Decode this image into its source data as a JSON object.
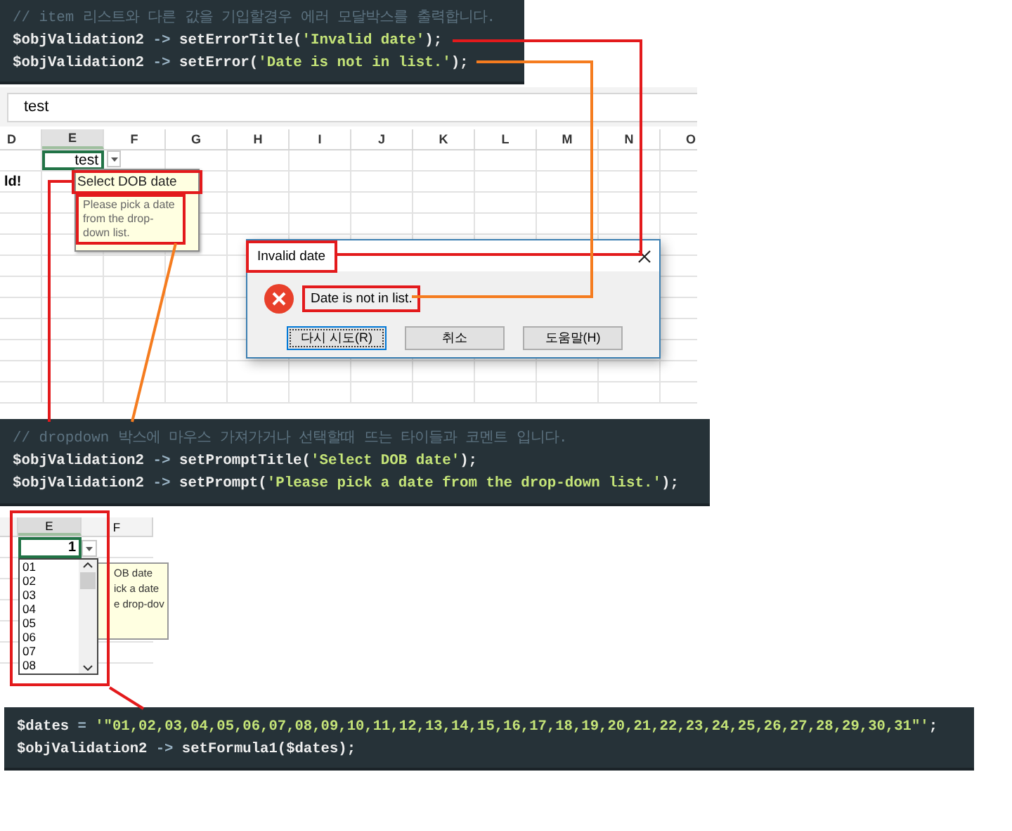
{
  "error_code": {
    "lines": [
      [
        {
          "kind": "comment",
          "text": "// item 리스트와 다른 값을 기입할경우 에러 모달박스를 출력합니다."
        }
      ],
      [
        {
          "kind": "plain",
          "text": "$objValidation2 "
        },
        {
          "kind": "operator",
          "text": "->"
        },
        {
          "kind": "plain",
          "text": " setErrorTitle("
        },
        {
          "kind": "string",
          "text": "'Invalid date'"
        },
        {
          "kind": "plain",
          "text": ");"
        }
      ],
      [
        {
          "kind": "plain",
          "text": "$objValidation2 "
        },
        {
          "kind": "operator",
          "text": "->"
        },
        {
          "kind": "plain",
          "text": " setError("
        },
        {
          "kind": "string",
          "text": "'Date is not in list.'"
        },
        {
          "kind": "plain",
          "text": ");"
        }
      ]
    ]
  },
  "spreadsheet": {
    "formula_bar": "test",
    "columns": [
      {
        "label": "D",
        "selected": false
      },
      {
        "label": "E",
        "selected": true
      },
      {
        "label": "F",
        "selected": false
      },
      {
        "label": "G",
        "selected": false
      },
      {
        "label": "H",
        "selected": false
      },
      {
        "label": "I",
        "selected": false
      },
      {
        "label": "J",
        "selected": false
      },
      {
        "label": "K",
        "selected": false
      },
      {
        "label": "L",
        "selected": false
      },
      {
        "label": "M",
        "selected": false
      },
      {
        "label": "N",
        "selected": false
      },
      {
        "label": "O",
        "selected": false
      }
    ],
    "active_cell": "test",
    "row_2_cell": "ld!",
    "input_message": {
      "title": "Select DOB date",
      "title_highlighted": true,
      "text": "Please pick a date from the drop-down list.",
      "text_highlighted": true
    }
  },
  "error_dialog": {
    "title": "Invalid date",
    "title_highlighted": true,
    "message": "Date is not in list.",
    "message_highlighted": true,
    "buttons": [
      {
        "label": "다시 시도(R)",
        "selected": true
      },
      {
        "label": "취소",
        "selected": false
      },
      {
        "label": "도움말(H)",
        "selected": false
      }
    ]
  },
  "prompt_code": {
    "lines": [
      [
        {
          "kind": "comment",
          "text": "// dropdown 박스에 마우스 가져가거나 선택할때 뜨는 타이들과 코멘트 입니다."
        }
      ],
      [
        {
          "kind": "plain",
          "text": "$objValidation2 "
        },
        {
          "kind": "operator",
          "text": "->"
        },
        {
          "kind": "plain",
          "text": " setPromptTitle("
        },
        {
          "kind": "string",
          "text": "'Select DOB date'"
        },
        {
          "kind": "plain",
          "text": ");"
        }
      ],
      [
        {
          "kind": "plain",
          "text": "$objValidation2 "
        },
        {
          "kind": "operator",
          "text": "->"
        },
        {
          "kind": "plain",
          "text": " setPrompt("
        },
        {
          "kind": "string",
          "text": "'Please pick a date from the drop-down list.'"
        },
        {
          "kind": "plain",
          "text": ");"
        }
      ]
    ]
  },
  "dropdown_sheet": {
    "highlighted": true,
    "columns": [
      {
        "label": "E",
        "selected": true
      },
      {
        "label": "F",
        "selected": false
      }
    ],
    "cell_value": "1",
    "options": [
      "01",
      "02",
      "03",
      "04",
      "05",
      "06",
      "07",
      "08"
    ],
    "input_message_lines": [
      "OB date",
      "ick a date",
      "e drop-dov"
    ]
  },
  "formula_code": {
    "lines": [
      [
        {
          "kind": "plain",
          "text": "$dates "
        },
        {
          "kind": "operator",
          "text": "="
        },
        {
          "kind": "string",
          "text": " '\"01,02,03,04,05,06,07,08,09,10,11,12,13,14,15,16,17,18,19,20,21,22,23,24,25,26,27,28,29,30,31\"'"
        },
        {
          "kind": "plain",
          "text": ";"
        }
      ],
      [
        {
          "kind": "plain",
          "text": "$objValidation2 "
        },
        {
          "kind": "operator",
          "text": "->"
        },
        {
          "kind": "plain",
          "text": " setFormula1($dates);"
        }
      ]
    ]
  },
  "connectors": [
    {
      "color": "#e31a1c"
    },
    {
      "color": "#f57c1f"
    },
    {
      "color": "#e31a1c"
    },
    {
      "color": "#f57c1f"
    },
    {
      "color": "#e31a1c"
    }
  ]
}
